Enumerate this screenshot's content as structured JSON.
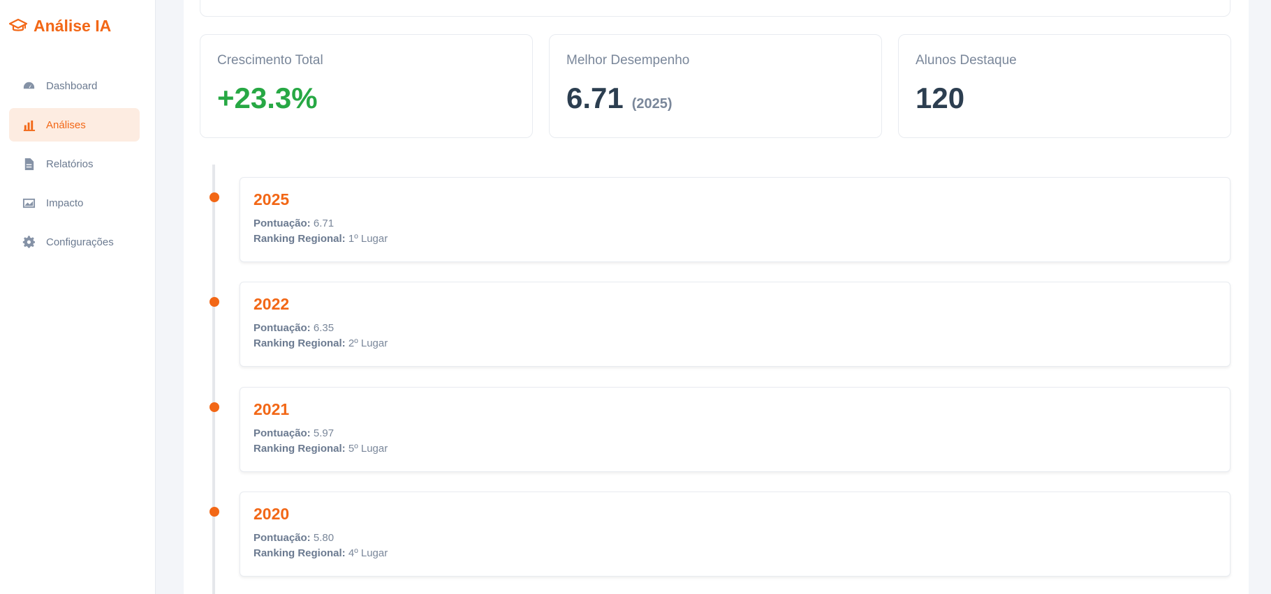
{
  "brand": {
    "name": "Análise IA",
    "icon": "graduation-cap-icon"
  },
  "sidebar": {
    "items": [
      {
        "label": "Dashboard",
        "icon": "gauge-icon",
        "active": false
      },
      {
        "label": "Análises",
        "icon": "bar-chart-icon",
        "active": true
      },
      {
        "label": "Relatórios",
        "icon": "document-icon",
        "active": false
      },
      {
        "label": "Impacto",
        "icon": "image-chart-icon",
        "active": false
      },
      {
        "label": "Configurações",
        "icon": "gear-icon",
        "active": false
      }
    ]
  },
  "stats": [
    {
      "label": "Crescimento Total",
      "value": "+23.3%",
      "sub": ""
    },
    {
      "label": "Melhor Desempenho",
      "value": "6.71",
      "sub": "(2025)"
    },
    {
      "label": "Alunos Destaque",
      "value": "120",
      "sub": ""
    }
  ],
  "timeline": {
    "score_label": "Pontuação:",
    "ranking_label": "Ranking Regional:",
    "entries": [
      {
        "year": "2025",
        "score": "6.71",
        "ranking": "1º Lugar"
      },
      {
        "year": "2022",
        "score": "6.35",
        "ranking": "2º Lugar"
      },
      {
        "year": "2021",
        "score": "5.97",
        "ranking": "5º Lugar"
      },
      {
        "year": "2020",
        "score": "5.80",
        "ranking": "4º Lugar"
      }
    ]
  },
  "colors": {
    "accent": "#f26716",
    "accent_bg": "#fdece1",
    "positive": "#27a844",
    "text_dark": "#2c3e50",
    "text_muted": "#7a879a"
  }
}
